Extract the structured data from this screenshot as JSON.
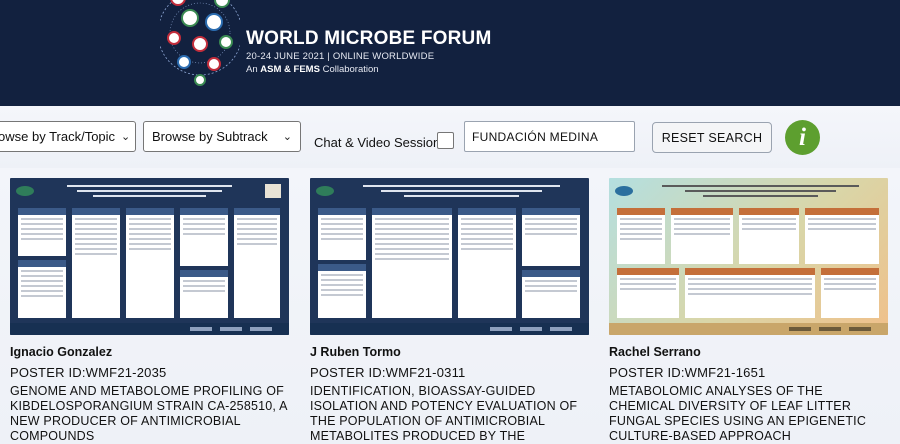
{
  "banner": {
    "title": "WORLD MICROBE FORUM",
    "dates": "20-24 JUNE 2021 | ONLINE WORLDWIDE",
    "collab_prefix": "An",
    "collab_org1": "ASM",
    "collab_amp": "&",
    "collab_org2": "FEMS",
    "collab_suffix": "Collaboration"
  },
  "filters": {
    "track_select": "owse by Track/Topic",
    "subtrack_select": "Browse by Subtrack",
    "chat_label": "Chat & Video Sessions:",
    "chat_checked": false,
    "search_value": "FUNDACIÓN MEDINA",
    "reset_label": "RESET SEARCH",
    "info_glyph": "i"
  },
  "colors": {
    "banner_bg": "#12213f",
    "info_green": "#5d9f2f",
    "poster_dark": "#1f3559"
  },
  "cards": [
    {
      "author": "Ignacio Gonzalez",
      "poster_id": "POSTER ID:WMF21-2035",
      "title": "GENOME AND METABOLOME PROFILING OF KIBDELOSPORANGIUM STRAIN CA-258510, A NEW PRODUCER OF ANTIMICROBIAL COMPOUNDS",
      "poster_style": "dark"
    },
    {
      "author": "J Ruben Tormo",
      "poster_id": "POSTER ID:WMF21-0311",
      "title": "IDENTIFICATION, BIOASSAY-GUIDED ISOLATION AND POTENCY EVALUATION OF THE POPULATION OF ANTIMICROBIAL METABOLITES PRODUCED BY THE",
      "poster_style": "dark"
    },
    {
      "author": "Rachel Serrano",
      "poster_id": "POSTER ID:WMF21-1651",
      "title": "METABOLOMIC ANALYSES OF THE CHEMICAL DIVERSITY OF LEAF LITTER FUNGAL SPECIES USING AN EPIGENETIC CULTURE-BASED APPROACH",
      "poster_style": "light"
    }
  ]
}
